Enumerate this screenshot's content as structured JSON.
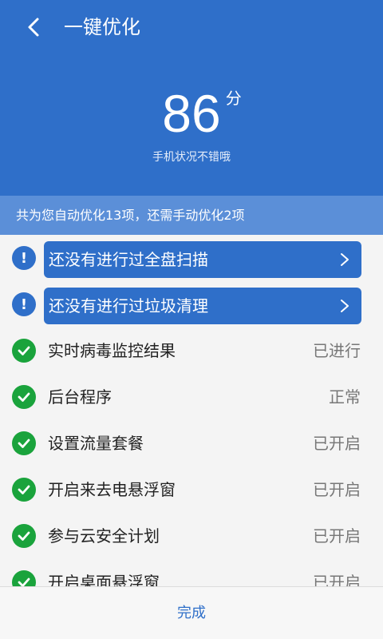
{
  "header": {
    "title": "一键优化",
    "score": "86",
    "score_unit": "分",
    "status": "手机状况不错哦"
  },
  "summary": {
    "text": "共为您自动优化13项，还需手动优化2项"
  },
  "actions": [
    {
      "icon": "exclamation-icon",
      "label": "还没有进行过全盘扫描"
    },
    {
      "icon": "exclamation-icon",
      "label": "还没有进行过垃圾清理"
    }
  ],
  "items": [
    {
      "icon": "check-icon",
      "label": "实时病毒监控结果",
      "value": "已进行"
    },
    {
      "icon": "check-icon",
      "label": "后台程序",
      "value": "正常"
    },
    {
      "icon": "check-icon",
      "label": "设置流量套餐",
      "value": "已开启"
    },
    {
      "icon": "check-icon",
      "label": "开启来去电悬浮窗",
      "value": "已开启"
    },
    {
      "icon": "check-icon",
      "label": "参与云安全计划",
      "value": "已开启"
    },
    {
      "icon": "check-icon",
      "label": "开启桌面悬浮窗",
      "value": "已开启"
    }
  ],
  "footer": {
    "done_label": "完成"
  },
  "colors": {
    "primary": "#2f6fc9",
    "summary_band": "#5b8fd8",
    "ok_green": "#1aa33c"
  }
}
